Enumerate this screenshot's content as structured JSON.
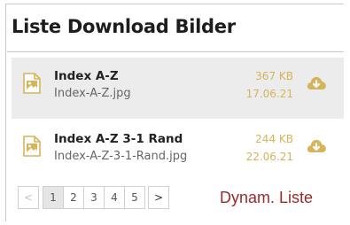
{
  "panel": {
    "title": "Liste Download Bilder"
  },
  "files": [
    {
      "name": "Index A-Z",
      "filename": "Index-A-Z.jpg",
      "size": "367 KB",
      "date": "17.06.21"
    },
    {
      "name": "Index A-Z 3-1 Rand",
      "filename": "Index-A-Z-3-1-Rand.jpg",
      "size": "244 KB",
      "date": "22.06.21"
    }
  ],
  "pagination": {
    "prev": "<",
    "pages": [
      "1",
      "2",
      "3",
      "4",
      "5"
    ],
    "active_page": "1",
    "next": ">"
  },
  "annotation": "Dynam. Liste",
  "colors": {
    "accent": "#d7b35a",
    "annotation": "#9b2a2a",
    "row_highlight": "#ececec"
  },
  "icons": {
    "file": "image-file-icon",
    "download": "cloud-download-icon"
  }
}
